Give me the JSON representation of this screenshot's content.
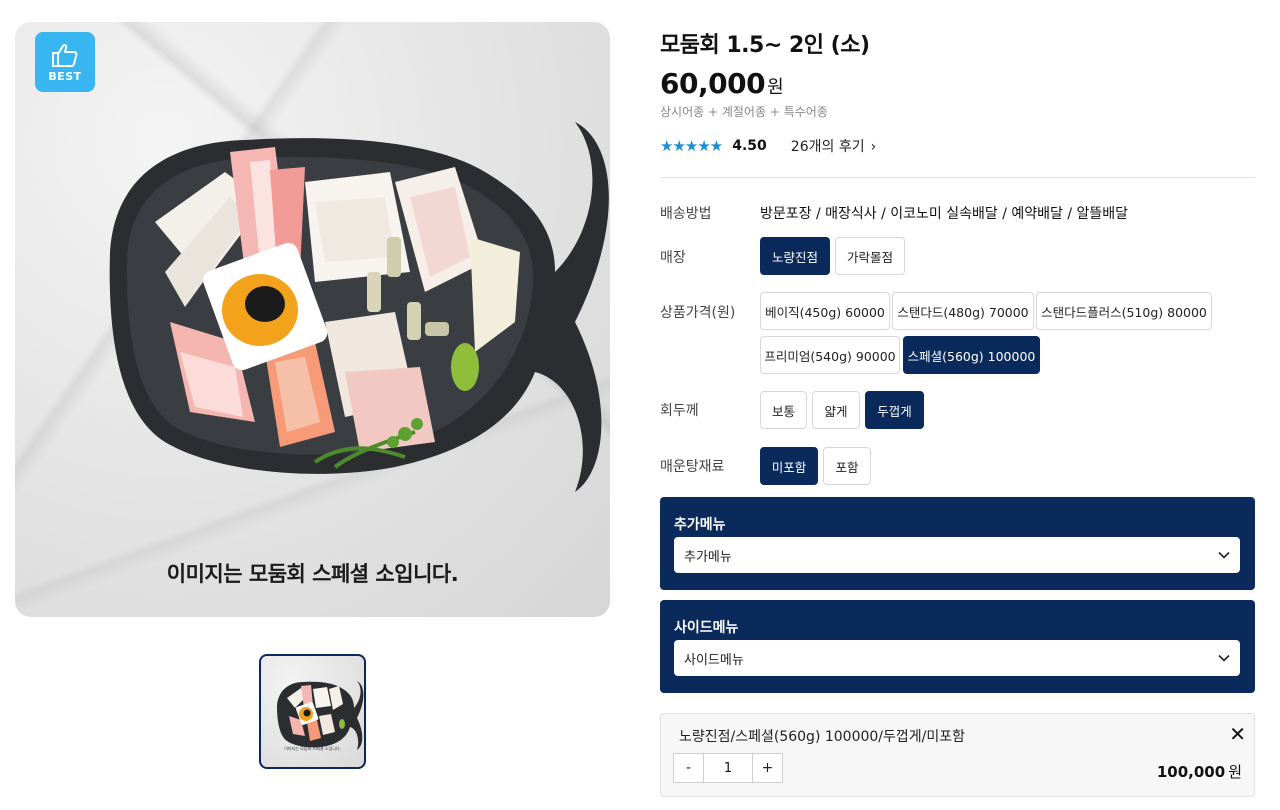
{
  "image": {
    "badge_label": "BEST",
    "caption": "이미지는 모둠회 스페셜 소입니다.",
    "thumb_caption": "이미지는 모둠회 스페셜 소입니다."
  },
  "product": {
    "title": "모둠회 1.5~ 2인 (소)",
    "price": "60,000",
    "price_unit": "원",
    "subtitle": "상시어종 + 계절어종 + 특수어종",
    "stars": "★★★★★",
    "rating": "4.50",
    "reviews": "26개의 후기",
    "reviews_chevron": "›"
  },
  "options": {
    "delivery": {
      "label": "배송방법",
      "value": "방문포장 / 매장식사 / 이코노미 실속배달 / 예약배달 / 알뜰배달"
    },
    "store": {
      "label": "매장",
      "choices": [
        "노량진점",
        "가락몰점"
      ],
      "selected_index": 0
    },
    "price": {
      "label": "상품가격(원)",
      "choices": [
        "베이직(450g) 60000",
        "스탠다드(480g) 70000",
        "스탠다드플러스(510g) 80000",
        "프리미엄(540g) 90000",
        "스페셜(560g) 100000"
      ],
      "selected_index": 4
    },
    "thickness": {
      "label": "회두께",
      "choices": [
        "보통",
        "얇게",
        "두껍게"
      ],
      "selected_index": 2
    },
    "stew": {
      "label": "매운탕재료",
      "choices": [
        "미포함",
        "포함"
      ],
      "selected_index": 0
    }
  },
  "addon_menu": {
    "title": "추가메뉴",
    "selected": "추가메뉴"
  },
  "side_menu": {
    "title": "사이드메뉴",
    "selected": "사이드메뉴"
  },
  "cart": {
    "item_name": "노량진점/스페셜(560g) 100000/두껍게/미포함",
    "close": "✕",
    "minus": "-",
    "quantity": "1",
    "plus": "+",
    "price": "100,000",
    "price_unit": "원"
  },
  "colors": {
    "accent": "#0b2a5c",
    "badge": "#38b6f1",
    "stars": "#1a8fd6"
  }
}
